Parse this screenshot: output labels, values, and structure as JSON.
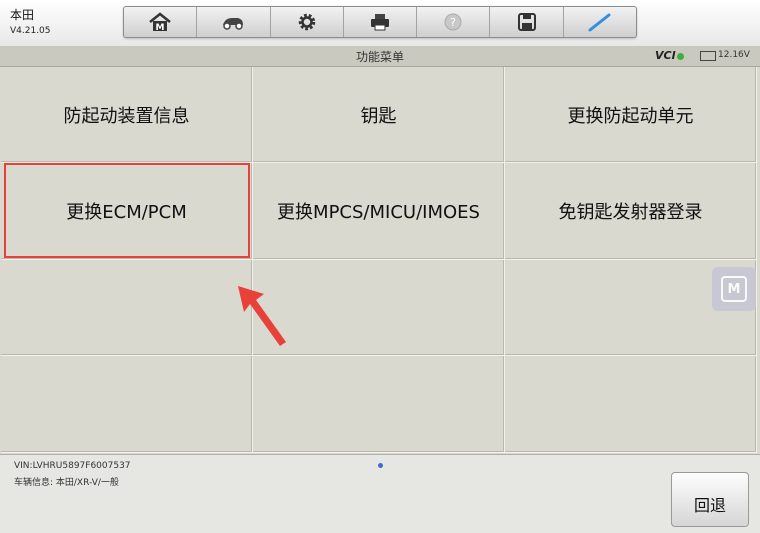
{
  "header": {
    "make": "本田",
    "version": "V4.21.05"
  },
  "toolbar": {
    "buttons": [
      "home-icon",
      "vehicle-switch-icon",
      "settings-gear-icon",
      "printer-icon",
      "help-icon",
      "save-icon",
      "pen-icon"
    ]
  },
  "titlebar": {
    "title": "功能菜单",
    "vci": "VCI",
    "voltage": "12.16V"
  },
  "menu": {
    "items": [
      "防起动装置信息",
      "钥匙",
      "更换防起动单元",
      "更换ECM/PCM",
      "更换MPCS/MICU/IMOES",
      "免钥匙发射器登录",
      "",
      "",
      "",
      "",
      "",
      ""
    ],
    "highlighted_index": 3
  },
  "footer": {
    "vin": "VIN:LVHRU5897F6007537",
    "vehicle_info": "车辆信息: 本田/XR-V/一般",
    "back_label": "回退"
  },
  "colors": {
    "highlight": "#e8413a",
    "arrow": "#e8413a",
    "vci_ok": "#3fae3a"
  }
}
